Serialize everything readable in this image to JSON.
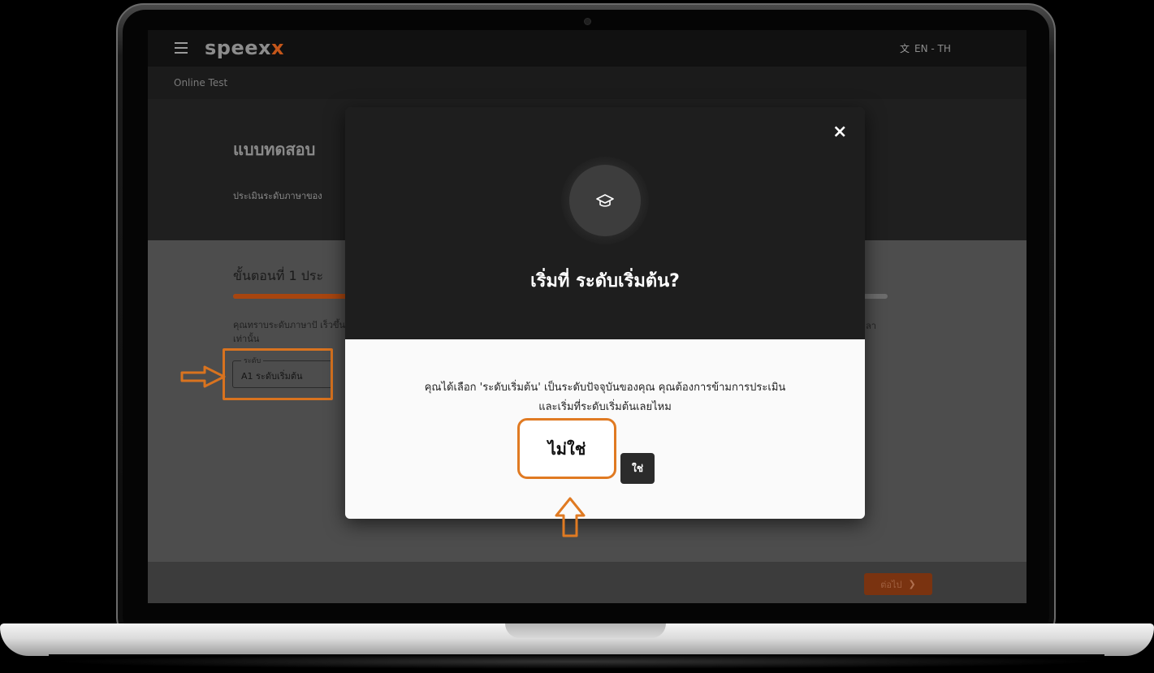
{
  "app": {
    "brand": "speex",
    "brand_accent": "x",
    "language_switch": "EN - TH",
    "page_title": "Online Test"
  },
  "hero": {
    "title": "แบบทดสอบ",
    "subtitle": "ประเมินระดับภาษาของ"
  },
  "step": {
    "title": "ขั้นตอนที่ 1 ประ",
    "progress": 0.19,
    "description": "คุณทราบระดับภาษาปั เร็วขึ้นเท่านั้น",
    "description_tail": "ลา"
  },
  "level_field": {
    "label": "ระดับ",
    "value": "A1 ระดับเริ่มต้น"
  },
  "footer": {
    "next_label": "ต่อไป"
  },
  "modal": {
    "title": "เริ่มที่ ระดับเริ่มต้น?",
    "message_line1": "คุณได้เลือก 'ระดับเริ่มต้น' เป็นระดับปัจจุบันของคุณ คุณต้องการข้ามการประเมิน",
    "message_line2": "และเริ่มที่ระดับเริ่มต้นเลยไหม",
    "no_label": "ไม่ใช่",
    "yes_label": "ใช่",
    "close_label": "×"
  },
  "colors": {
    "accent": "#d9731f",
    "modal_dark": "#1e1e1e",
    "modal_light": "#fafafa"
  },
  "icons": {
    "menu": "hamburger-icon",
    "translate": "translate-icon",
    "avatar": "graduation-cap-icon",
    "close": "close-icon",
    "next": "chevron-right-icon"
  }
}
